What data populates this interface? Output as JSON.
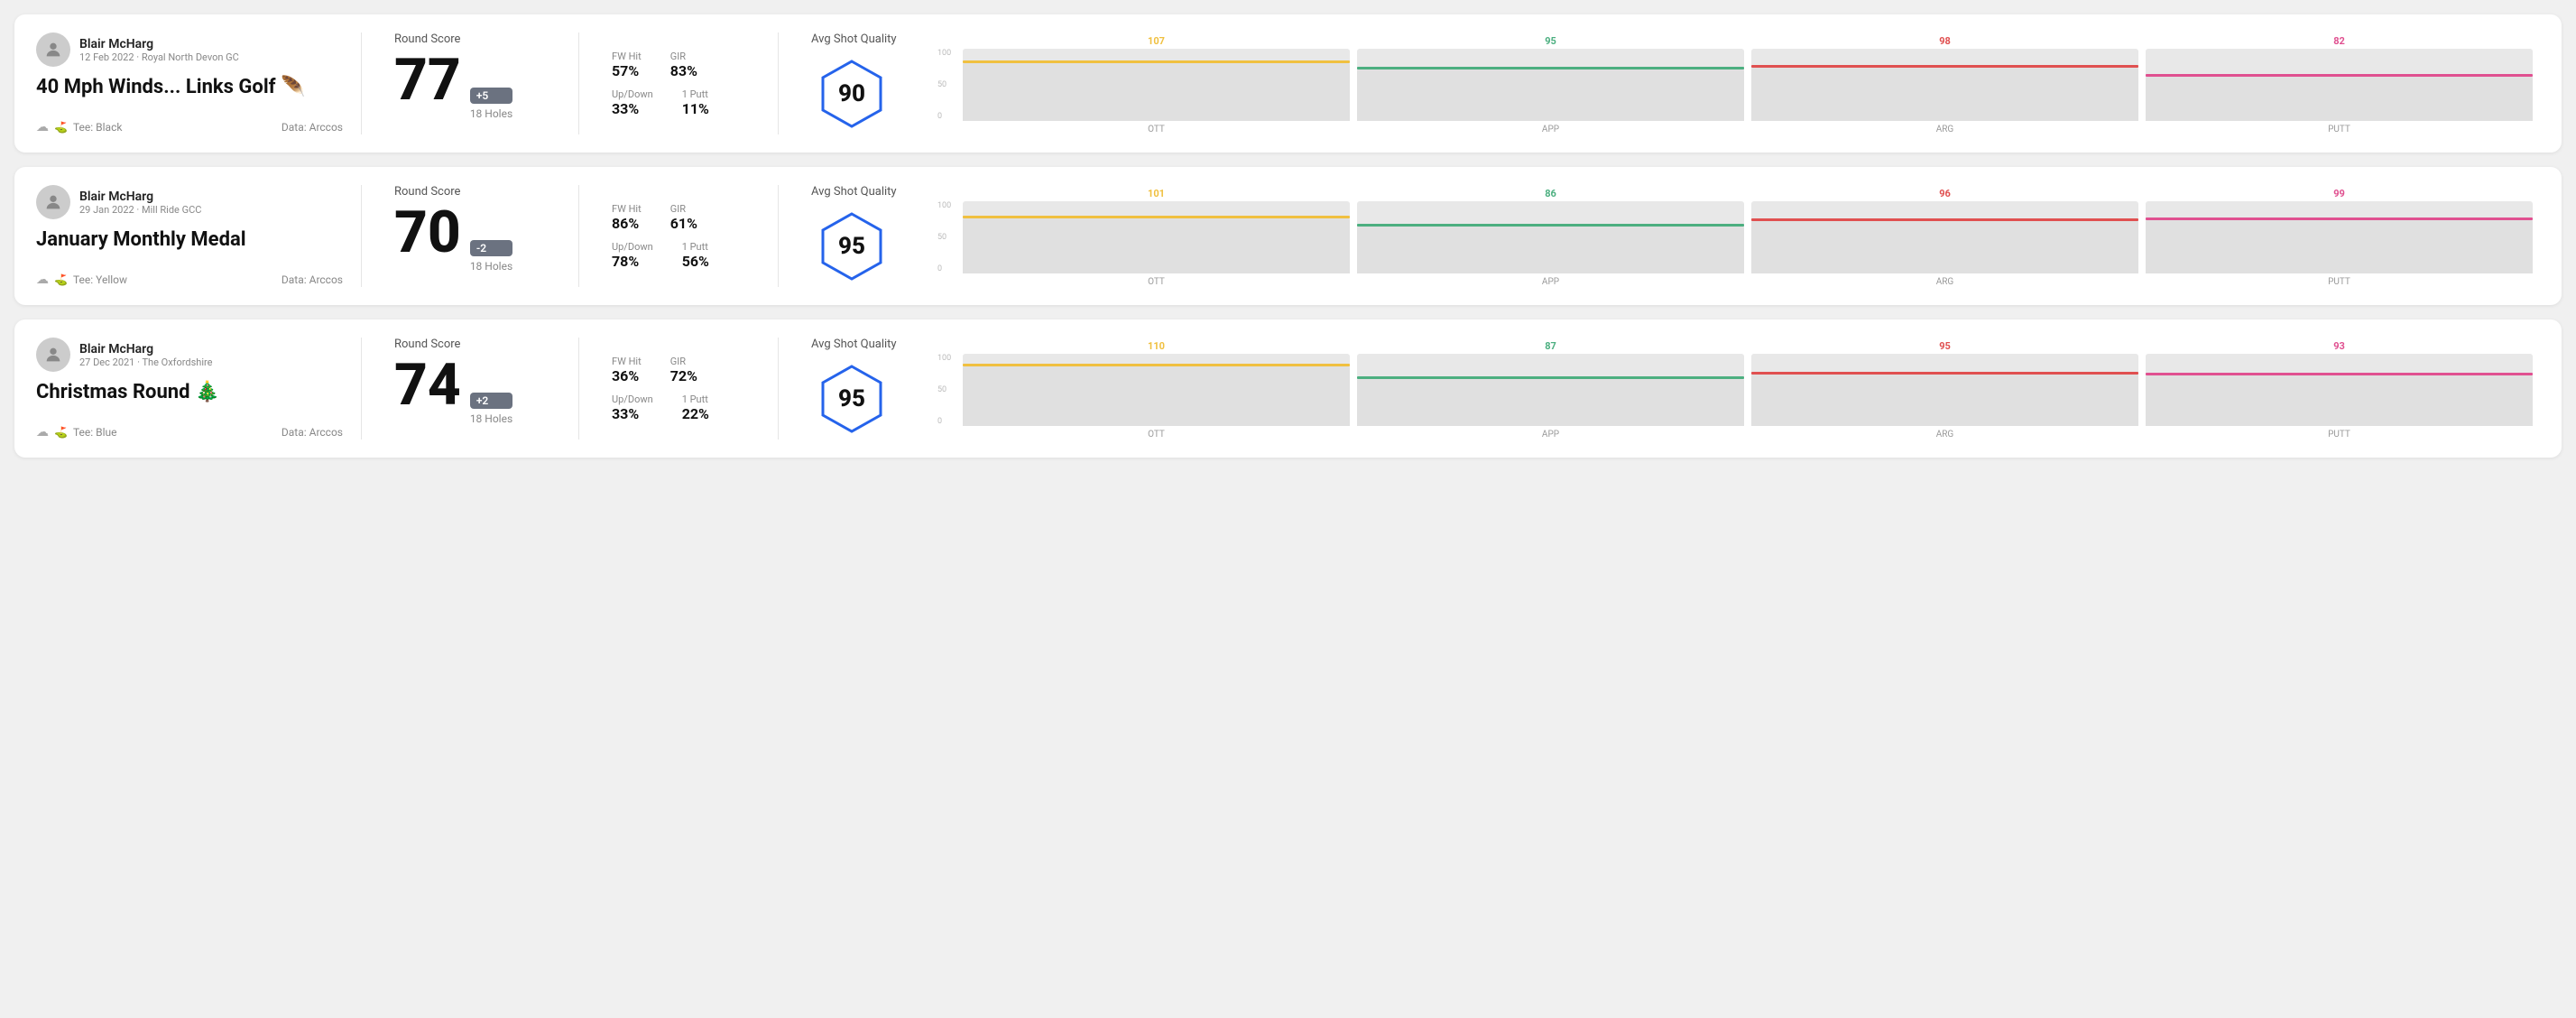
{
  "rounds": [
    {
      "id": "round1",
      "user": {
        "name": "Blair McHarg",
        "meta": "12 Feb 2022 · Royal North Devon GC"
      },
      "title": "40 Mph Winds... Links Golf 🪶",
      "tee": "Black",
      "data_source": "Data: Arccos",
      "score": "77",
      "score_diff": "+5",
      "holes": "18 Holes",
      "fw_hit": "57%",
      "gir": "83%",
      "up_down": "33%",
      "one_putt": "11%",
      "avg_shot_quality": "90",
      "chart": {
        "ott": {
          "value": 107,
          "color": "#f0c040"
        },
        "app": {
          "value": 95,
          "color": "#4caf80"
        },
        "arg": {
          "value": 98,
          "color": "#e05050"
        },
        "putt": {
          "value": 82,
          "color": "#e05090"
        }
      }
    },
    {
      "id": "round2",
      "user": {
        "name": "Blair McHarg",
        "meta": "29 Jan 2022 · Mill Ride GCC"
      },
      "title": "January Monthly Medal",
      "tee": "Yellow",
      "data_source": "Data: Arccos",
      "score": "70",
      "score_diff": "-2",
      "holes": "18 Holes",
      "fw_hit": "86%",
      "gir": "61%",
      "up_down": "78%",
      "one_putt": "56%",
      "avg_shot_quality": "95",
      "chart": {
        "ott": {
          "value": 101,
          "color": "#f0c040"
        },
        "app": {
          "value": 86,
          "color": "#4caf80"
        },
        "arg": {
          "value": 96,
          "color": "#e05050"
        },
        "putt": {
          "value": 99,
          "color": "#e05090"
        }
      }
    },
    {
      "id": "round3",
      "user": {
        "name": "Blair McHarg",
        "meta": "27 Dec 2021 · The Oxfordshire"
      },
      "title": "Christmas Round 🎄",
      "tee": "Blue",
      "data_source": "Data: Arccos",
      "score": "74",
      "score_diff": "+2",
      "holes": "18 Holes",
      "fw_hit": "36%",
      "gir": "72%",
      "up_down": "33%",
      "one_putt": "22%",
      "avg_shot_quality": "95",
      "chart": {
        "ott": {
          "value": 110,
          "color": "#f0c040"
        },
        "app": {
          "value": 87,
          "color": "#4caf80"
        },
        "arg": {
          "value": 95,
          "color": "#e05050"
        },
        "putt": {
          "value": 93,
          "color": "#e05090"
        }
      }
    }
  ],
  "labels": {
    "round_score": "Round Score",
    "fw_hit": "FW Hit",
    "gir": "GIR",
    "up_down": "Up/Down",
    "one_putt": "1 Putt",
    "avg_shot_quality": "Avg Shot Quality",
    "ott": "OTT",
    "app": "APP",
    "arg": "ARG",
    "putt": "PUTT",
    "tee_prefix": "Tee: ",
    "chart_y_100": "100",
    "chart_y_50": "50",
    "chart_y_0": "0"
  }
}
